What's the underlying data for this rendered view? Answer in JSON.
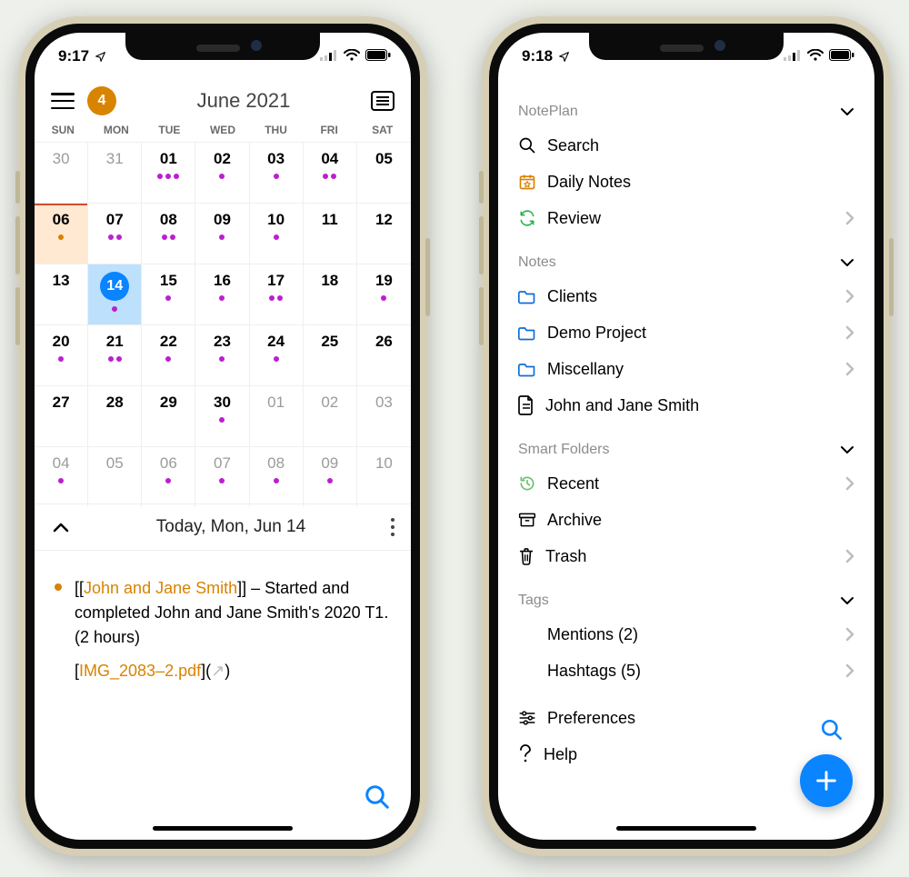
{
  "left": {
    "status": {
      "time": "9:17"
    },
    "header": {
      "title": "June 2021",
      "overdue_count": "4"
    },
    "weekday_labels": [
      "SUN",
      "MON",
      "TUE",
      "WED",
      "THU",
      "FRI",
      "SAT"
    ],
    "weeks": [
      [
        {
          "n": "30",
          "dim": true
        },
        {
          "n": "31",
          "dim": true
        },
        {
          "n": "01",
          "dc": 3
        },
        {
          "n": "02",
          "dc": 1
        },
        {
          "n": "03",
          "dc": 1
        },
        {
          "n": "04",
          "dc": 2
        },
        {
          "n": "05"
        }
      ],
      [
        {
          "n": "06",
          "today": true,
          "oc": 1
        },
        {
          "n": "07",
          "dc": 2
        },
        {
          "n": "08",
          "dc": 2
        },
        {
          "n": "09",
          "dc": 1
        },
        {
          "n": "10",
          "dc": 1
        },
        {
          "n": "11"
        },
        {
          "n": "12"
        }
      ],
      [
        {
          "n": "13"
        },
        {
          "n": "14",
          "sel": true,
          "dc": 1
        },
        {
          "n": "15",
          "dc": 1
        },
        {
          "n": "16",
          "dc": 1
        },
        {
          "n": "17",
          "dc": 2
        },
        {
          "n": "18"
        },
        {
          "n": "19",
          "dc": 1
        }
      ],
      [
        {
          "n": "20",
          "dc": 1
        },
        {
          "n": "21",
          "dc": 2
        },
        {
          "n": "22",
          "dc": 1
        },
        {
          "n": "23",
          "dc": 1
        },
        {
          "n": "24",
          "dc": 1
        },
        {
          "n": "25"
        },
        {
          "n": "26"
        }
      ],
      [
        {
          "n": "27"
        },
        {
          "n": "28"
        },
        {
          "n": "29"
        },
        {
          "n": "30",
          "dc": 1
        },
        {
          "n": "01",
          "dim": true
        },
        {
          "n": "02",
          "dim": true
        },
        {
          "n": "03",
          "dim": true
        }
      ],
      [
        {
          "n": "04",
          "dim": true,
          "dc": 1
        },
        {
          "n": "05",
          "dim": true
        },
        {
          "n": "06",
          "dim": true,
          "dc": 1
        },
        {
          "n": "07",
          "dim": true,
          "dc": 1
        },
        {
          "n": "08",
          "dim": true,
          "dc": 1
        },
        {
          "n": "09",
          "dim": true,
          "dc": 1
        },
        {
          "n": "10",
          "dim": true
        }
      ]
    ],
    "today_bar": "Today, Mon, Jun 14",
    "note": {
      "open": "[[",
      "link_text": "John and Jane Smith",
      "close": "]]",
      "body_suffix": " – Started and completed John and Jane Smith's 2020 T1. (2 hours)",
      "attach_open": "[",
      "attach_name": "IMG_2083–2.pdf",
      "attach_between": "](",
      "attach_glyph": "↗",
      "attach_close": ")"
    }
  },
  "right": {
    "status": {
      "time": "9:18"
    },
    "sections": {
      "app": "NotePlan",
      "notes": "Notes",
      "smart": "Smart Folders",
      "tags": "Tags"
    },
    "items": {
      "search": "Search",
      "daily": "Daily Notes",
      "review": "Review",
      "clients": "Clients",
      "demo": "Demo Project",
      "misc": "Miscellany",
      "jjs": "John and Jane Smith",
      "recent": "Recent",
      "archive": "Archive",
      "trash": "Trash",
      "mentions": "Mentions (2)",
      "hashtags": "Hashtags (5)",
      "prefs": "Preferences",
      "help": "Help"
    }
  }
}
